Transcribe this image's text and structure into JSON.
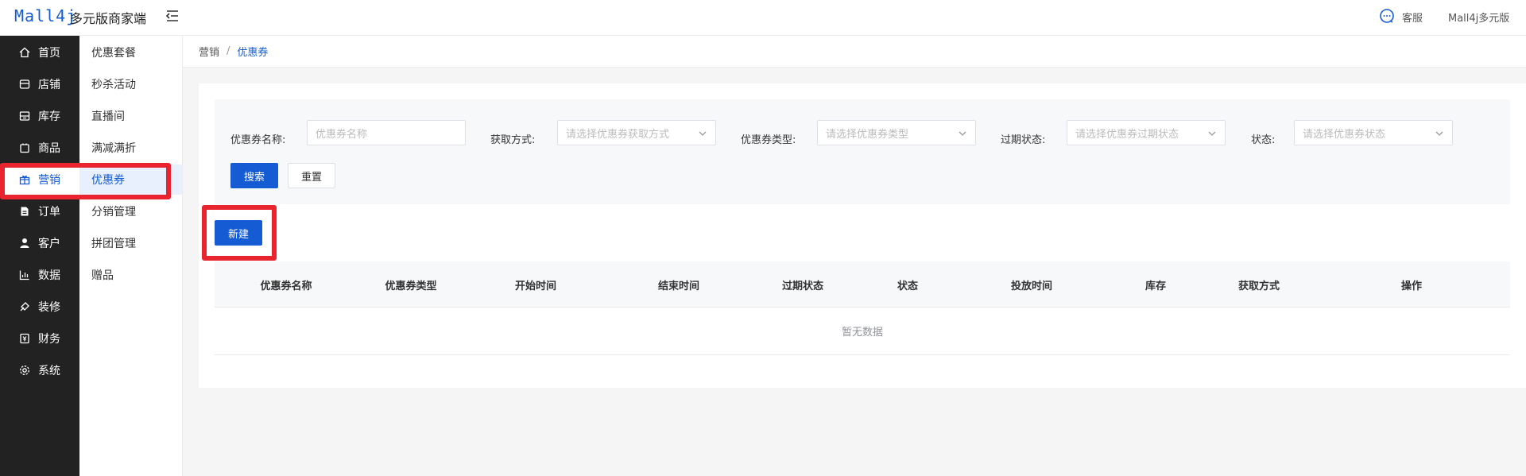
{
  "header": {
    "logo": "Mall4j",
    "brand": "多元版商家端",
    "service_label": "客服",
    "user_name": "Mall4j多元版"
  },
  "sidebar": {
    "items": [
      {
        "label": "首页",
        "icon": "home-icon"
      },
      {
        "label": "店铺",
        "icon": "shop-icon"
      },
      {
        "label": "库存",
        "icon": "inventory-icon"
      },
      {
        "label": "商品",
        "icon": "product-icon"
      },
      {
        "label": "营销",
        "icon": "gift-icon",
        "active": true
      },
      {
        "label": "订单",
        "icon": "order-icon"
      },
      {
        "label": "客户",
        "icon": "customer-icon"
      },
      {
        "label": "数据",
        "icon": "chart-icon"
      },
      {
        "label": "装修",
        "icon": "decorate-icon"
      },
      {
        "label": "财务",
        "icon": "finance-icon"
      },
      {
        "label": "系统",
        "icon": "settings-icon"
      }
    ]
  },
  "submenu": {
    "items": [
      {
        "label": "优惠套餐"
      },
      {
        "label": "秒杀活动"
      },
      {
        "label": "直播间"
      },
      {
        "label": "满减满折"
      },
      {
        "label": "优惠券",
        "active": true
      },
      {
        "label": "分销管理"
      },
      {
        "label": "拼团管理"
      },
      {
        "label": "赠品"
      }
    ]
  },
  "breadcrumb": {
    "parent": "营销",
    "separator": "/",
    "current": "优惠券"
  },
  "search": {
    "fields": [
      {
        "label": "优惠券名称:",
        "placeholder": "优惠券名称",
        "type": "input"
      },
      {
        "label": "获取方式:",
        "placeholder": "请选择优惠券获取方式",
        "type": "select"
      },
      {
        "label": "优惠券类型:",
        "placeholder": "请选择优惠券类型",
        "type": "select"
      },
      {
        "label": "过期状态:",
        "placeholder": "请选择优惠券过期状态",
        "type": "select"
      },
      {
        "label": "状态:",
        "placeholder": "请选择优惠券状态",
        "type": "select"
      }
    ],
    "search_label": "搜索",
    "reset_label": "重置"
  },
  "actions": {
    "new_label": "新建"
  },
  "table": {
    "columns": [
      "优惠券名称",
      "优惠券类型",
      "开始时间",
      "结束时间",
      "过期状态",
      "状态",
      "投放时间",
      "库存",
      "获取方式",
      "操作"
    ],
    "empty_text": "暂无数据"
  },
  "colors": {
    "primary": "#155bd4",
    "sidebar_bg": "#222222",
    "highlight": "#e8242f"
  }
}
